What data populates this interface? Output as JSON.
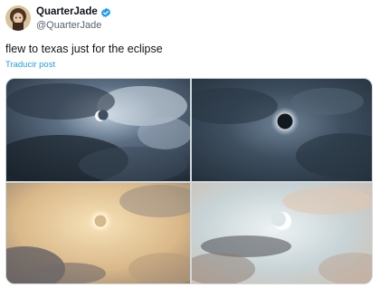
{
  "author": {
    "display_name": "QuarterJade",
    "handle": "@QuarterJade",
    "verified_icon": "verified-badge-icon",
    "avatar_icon": "avatar"
  },
  "tweet": {
    "text": "flew to texas just for the eclipse",
    "translate_label": "Traducir post"
  },
  "media": [
    {
      "name": "eclipse-photo-partial-crescent"
    },
    {
      "name": "eclipse-photo-totality-corona"
    },
    {
      "name": "eclipse-photo-golden-clouds"
    },
    {
      "name": "eclipse-photo-pastel-sky"
    }
  ],
  "colors": {
    "link": "#1d9bf0",
    "secondary_text": "#536471",
    "primary_text": "#0f1419",
    "verified": "#1d9bf0"
  }
}
